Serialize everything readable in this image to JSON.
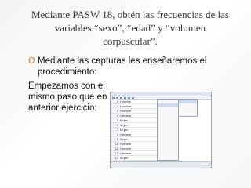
{
  "title": "Mediante PASW 18, obtén las frecuencias de las variables “sexo”, “edad” y “volumen corpuscular”.",
  "bullets": [
    {
      "glyph": "O",
      "text": "Mediante las capturas les enseñaremos el procedimiento:"
    }
  ],
  "body_text": "Empezamos con el mismo paso que en el anterior ejercicio:",
  "screenshot": {
    "sexo_values": [
      "Hombre",
      "Hombre",
      "Hombre",
      "Hombre",
      "Mujer",
      "Mujer",
      "Mujer",
      "Hombre",
      "Mujer",
      "Hombre",
      "Hombre",
      "Hombre",
      "Mujer",
      "Mujer",
      "Mujer"
    ],
    "grupo_values": [
      "",
      "",
      "",
      "",
      "",
      "",
      "",
      "",
      "",
      "",
      "",
      "",
      "",
      "",
      ""
    ]
  },
  "colors": {
    "bullet": "#d47a2a",
    "title": "#333333",
    "text": "#111111"
  }
}
